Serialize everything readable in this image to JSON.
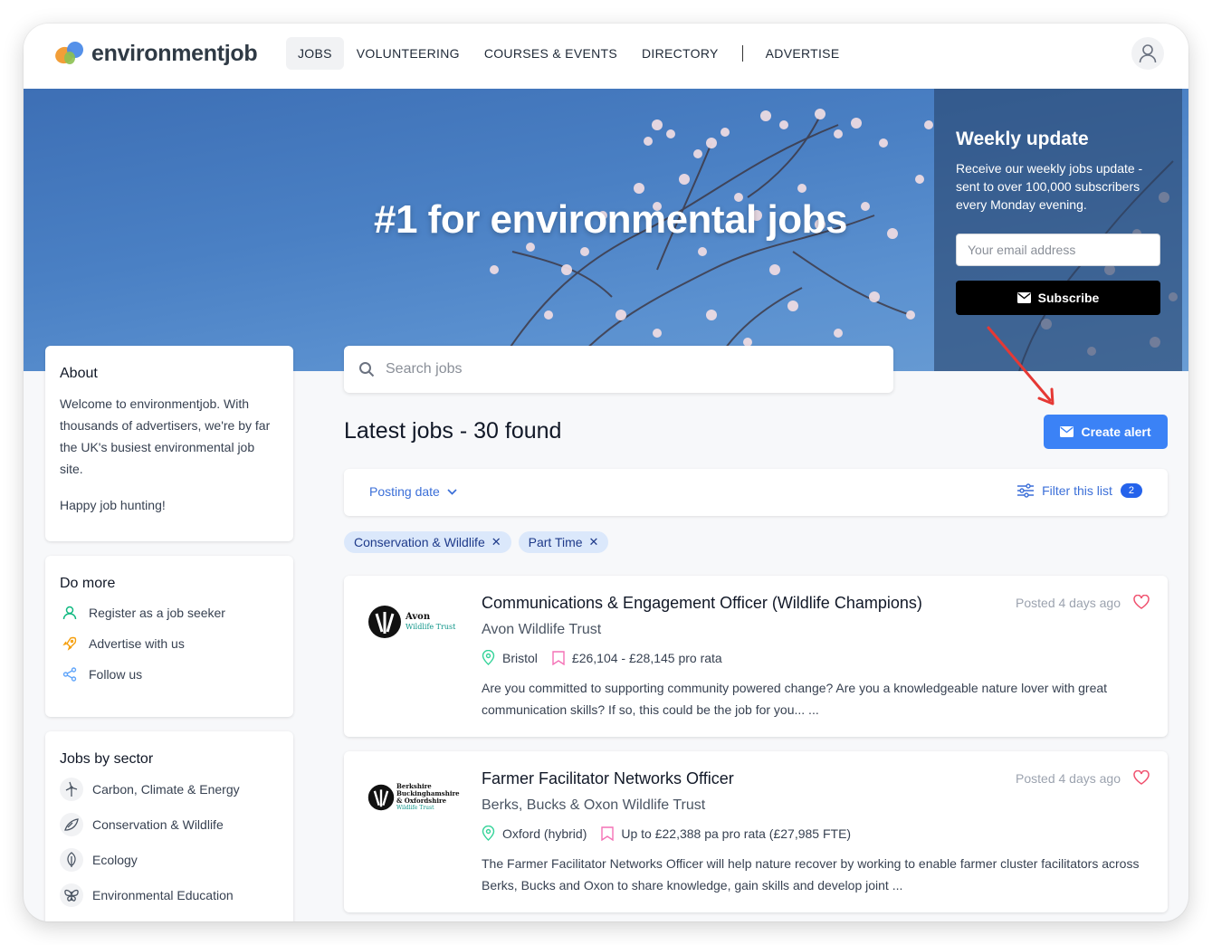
{
  "brand": {
    "name": "environmentjob"
  },
  "nav": {
    "items": [
      "JOBS",
      "VOLUNTEERING",
      "COURSES & EVENTS",
      "DIRECTORY",
      "ADVERTISE"
    ],
    "active": "JOBS"
  },
  "hero": {
    "title": "#1 for environmental jobs"
  },
  "weekly": {
    "title": "Weekly update",
    "text": "Receive our weekly jobs update - sent to over 100,000 subscribers every Monday evening.",
    "email_placeholder": "Your email address",
    "subscribe_label": "Subscribe"
  },
  "about": {
    "title": "About",
    "text": "Welcome to environmentjob. With thousands of advertisers, we're by far the UK's busiest environmental job site.",
    "sign_off": "Happy job hunting!"
  },
  "do_more": {
    "title": "Do more",
    "items": [
      {
        "label": "Register as a job seeker",
        "icon": "user-icon"
      },
      {
        "label": "Advertise with us",
        "icon": "rocket-icon"
      },
      {
        "label": "Follow us",
        "icon": "share-icon"
      }
    ]
  },
  "sectors": {
    "title": "Jobs by sector",
    "items": [
      {
        "label": "Carbon, Climate & Energy",
        "icon": "wind-turbine-icon"
      },
      {
        "label": "Conservation & Wildlife",
        "icon": "bird-icon"
      },
      {
        "label": "Ecology",
        "icon": "leaf-icon"
      },
      {
        "label": "Environmental Education",
        "icon": "butterfly-icon"
      }
    ]
  },
  "search": {
    "placeholder": "Search jobs"
  },
  "results": {
    "heading": "Latest jobs - 30 found",
    "create_alert_label": "Create alert",
    "sort_label": "Posting date",
    "filter_label": "Filter this list",
    "filter_count": "2",
    "chips": [
      "Conservation & Wildlife",
      "Part Time"
    ]
  },
  "jobs": [
    {
      "title": "Communications & Engagement Officer (Wildlife Champions)",
      "company": "Avon Wildlife Trust",
      "location": "Bristol",
      "salary": "£26,104 - £28,145 pro rata",
      "posted": "Posted 4 days ago",
      "description": "Are you committed to supporting community powered change? Are you a knowledgeable nature lover with great communication skills? If so, this could be the job for you... ...",
      "logo_text": [
        "Avon",
        "Wildlife Trust"
      ]
    },
    {
      "title": "Farmer Facilitator Networks Officer",
      "company": "Berks, Bucks & Oxon Wildlife Trust",
      "location": "Oxford (hybrid)",
      "salary": "Up to £22,388 pa pro rata (£27,985 FTE)",
      "posted": "Posted 4 days ago",
      "description": "The Farmer Facilitator Networks Officer will help nature recover by working to enable farmer cluster facilitators across Berks, Bucks and Oxon to share knowledge, gain skills and develop joint ...",
      "logo_text": [
        "Berkshire",
        "Buckinghamshire",
        "& Oxfordshire",
        "Wildlife Trust"
      ]
    }
  ],
  "colors": {
    "accent": "#3b82f6",
    "link": "#3b6fd8",
    "chip_bg": "#dbe8fb",
    "arrow": "#e53935"
  }
}
